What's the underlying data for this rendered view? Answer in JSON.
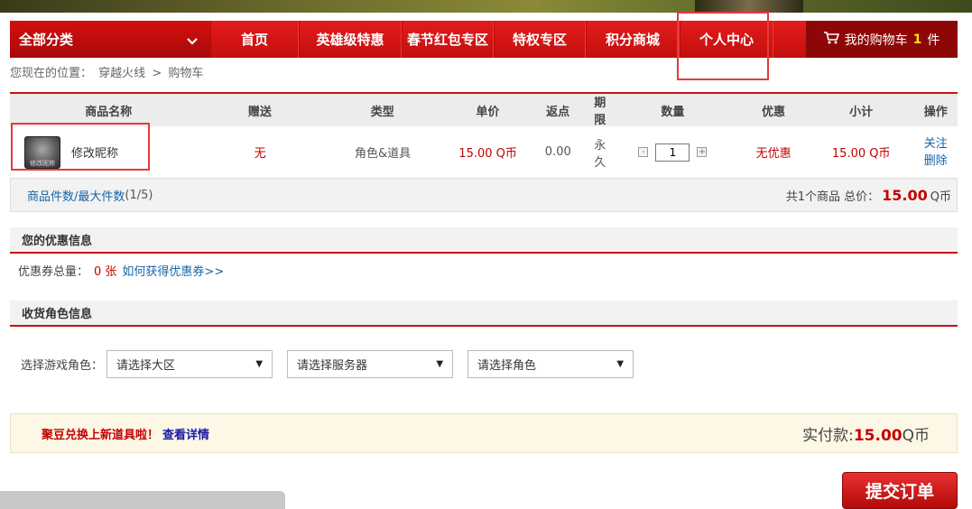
{
  "nav": {
    "all_categories": "全部分类",
    "items": [
      "首页",
      "英雄级特惠",
      "春节红包专区",
      "特权专区",
      "积分商城",
      "个人中心"
    ],
    "cart_label": "我的购物车",
    "cart_count": "1",
    "cart_unit": "件"
  },
  "breadcrumb": {
    "prefix": "您现在的位置：",
    "game": "穿越火线",
    "separator": ">",
    "current": "购物车"
  },
  "table": {
    "headers": [
      "商品名称",
      "赠送",
      "类型",
      "单价",
      "返点",
      "期限",
      "数量",
      "优惠",
      "小计",
      "操作"
    ],
    "row": {
      "name": "修改昵称",
      "thumb_text": "修改昵称",
      "gift": "无",
      "type": "角色&道具",
      "price": "15.00 Q币",
      "rebate": "0.00",
      "term": "永久",
      "qty_minus": "-",
      "qty": "1",
      "qty_plus": "+",
      "discount": "无优惠",
      "subtotal": "15.00 Q币",
      "op_follow": "关注",
      "op_delete": "删除"
    }
  },
  "summary": {
    "item_count_label": "商品件数/最大件数",
    "item_count_value": "(1/5)",
    "total_prefix": "共1个商品 总价：",
    "total_value": "15.00",
    "total_unit": "Q币"
  },
  "coupon_section": {
    "title": "您的优惠信息",
    "label": "优惠券总量：",
    "count": "0 张",
    "link": "如何获得优惠券>>"
  },
  "role_section": {
    "title": "收货角色信息",
    "label": "选择游戏角色：",
    "region": "请选择大区",
    "server": "请选择服务器",
    "role": "请选择角色"
  },
  "promo": {
    "message": "聚豆兑换上新道具啦！",
    "more": "查看详情",
    "pay_label": "实付款:",
    "pay_value": "15.00",
    "pay_unit": "Q币"
  },
  "submit_label": "提交订单",
  "colors": {
    "brand_red": "#c91212",
    "price_red": "#c40000",
    "link_blue": "#1565a8",
    "annotation_red": "#e53b3b"
  }
}
